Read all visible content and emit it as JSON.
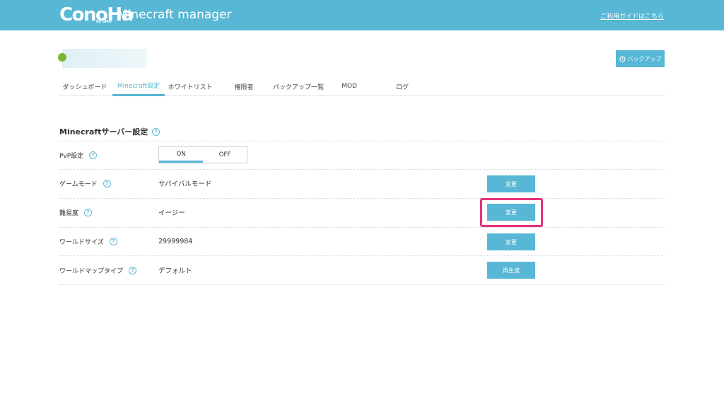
{
  "header": {
    "logo_text": "ConoHa",
    "logo_sub": "by GMO",
    "app_title": "Minecraft manager",
    "guide_link": "ご利用ガイドはこちら",
    "background": "#58b7d4"
  },
  "toolbar": {
    "backup_label": "バックアップ"
  },
  "tabs": [
    {
      "label": "ダッシュボード"
    },
    {
      "label": "Minecraft設定",
      "active": true
    },
    {
      "label": "ホワイトリスト"
    },
    {
      "label": "権限者"
    },
    {
      "label": "バックアップ一覧"
    },
    {
      "label": "MOD"
    },
    {
      "label": "ログ"
    }
  ],
  "settings": {
    "title": "Minecraftサーバー設定",
    "pvp": {
      "label": "PvP設定",
      "on_label": "ON",
      "off_label": "OFF",
      "selected": "ON"
    },
    "rows": [
      {
        "label": "ゲームモード",
        "value": "サバイバルモード",
        "button": "変更"
      },
      {
        "label": "難易度",
        "value": "イージー",
        "button": "変更"
      },
      {
        "label": "ワールドサイズ",
        "value": "29999984",
        "button": "変更"
      },
      {
        "label": "ワールドマップタイプ",
        "value": "デフォルト",
        "button": "再生成"
      }
    ]
  },
  "colors": {
    "accent": "#58b7d4",
    "highlight": "#e8317a",
    "server_status": "#7ab630"
  }
}
